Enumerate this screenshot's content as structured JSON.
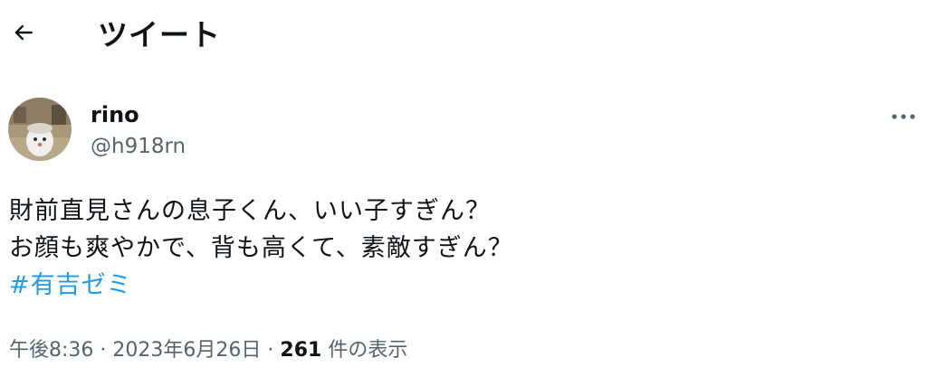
{
  "header": {
    "back_icon": "arrow-left-icon",
    "title": "ツイート"
  },
  "tweet": {
    "author": {
      "display_name": "rino",
      "handle": "@h918rn",
      "avatar_icon": "avatar-photo"
    },
    "more_icon": "more-horizontal-icon",
    "text_lines": [
      "財前直見さんの息子くん、いい子すぎん？",
      "お顔も爽やかで、背も高くて、素敵すぎん？"
    ],
    "hashtag": "#有吉ゼミ",
    "time": "午後8:36",
    "separator": "·",
    "date": "2023年6月26日",
    "views_count": "261",
    "views_label": "件の表示"
  },
  "colors": {
    "text": "#0f1419",
    "secondary": "#536471",
    "link": "#1d9bf0"
  }
}
